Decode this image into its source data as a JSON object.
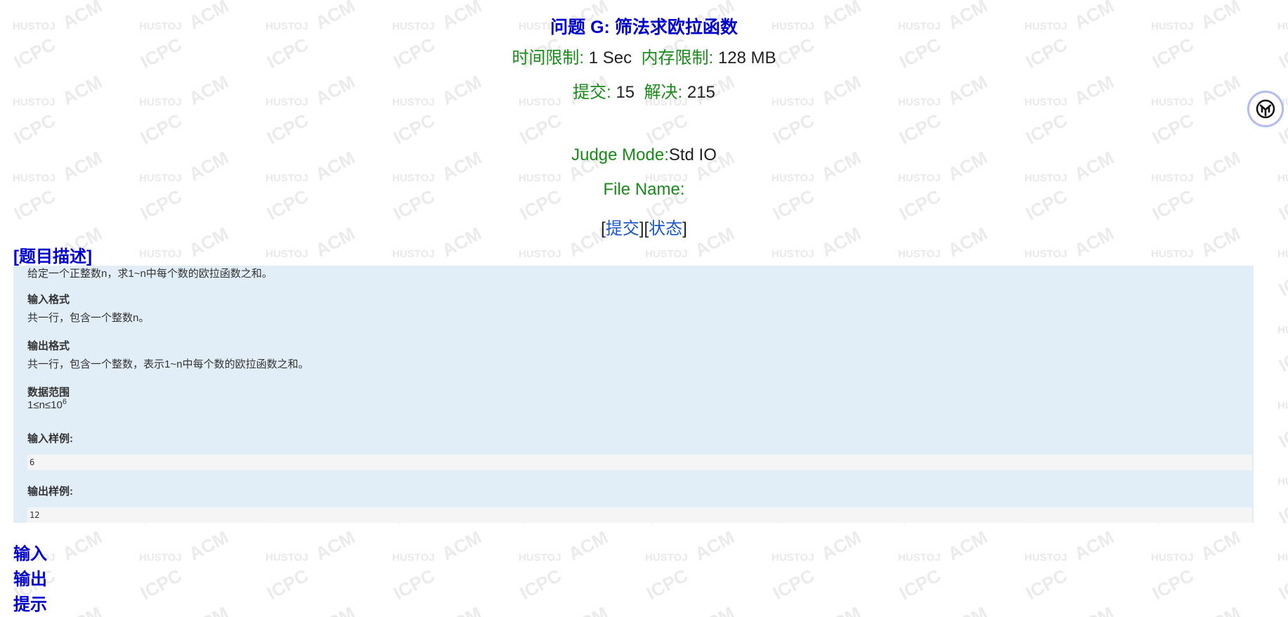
{
  "problem": {
    "title": "问题 G: 筛法求欧拉函数",
    "time_limit_label": "时间限制: ",
    "time_limit_value": "1 Sec",
    "mem_limit_label": "内存限制: ",
    "mem_limit_value": "128 MB",
    "submit_label": "提交: ",
    "submit_value": "15",
    "solved_label": "解决: ",
    "solved_value": "215",
    "judge_mode_label": "Judge Mode:",
    "judge_mode_value": "Std IO",
    "file_name_label": "File Name:",
    "bracket_open": "[",
    "bracket_mid": "][",
    "bracket_close": "]",
    "submit_link": "提交",
    "status_link": "状态"
  },
  "description": {
    "heading": "[题目描述]",
    "intro": "给定一个正整数n，求1~n中每个数的欧拉函数之和。",
    "input_format_title": "输入格式",
    "input_format_text": "共一行，包含一个整数n。",
    "output_format_title": "输出格式",
    "output_format_text": "共一行，包含一个整数，表示1~n中每个数的欧拉函数之和。",
    "range_title": "数据范围",
    "range_base": "1≤n≤10",
    "range_exp": "6",
    "sample_input_title": "输入样例:",
    "sample_input": "6",
    "sample_output_title": "输出样例:",
    "sample_output": "12"
  },
  "sections": {
    "input": "输入",
    "output": "输出",
    "hint": "提示"
  },
  "watermark": {
    "words": [
      "HUSTOJ",
      "ACM",
      "ICPC"
    ]
  },
  "colors": {
    "title": "#0000cc",
    "label_green": "#1a8a1a",
    "link_blue": "#1a56c8",
    "desc_bg": "#e2eef7"
  }
}
